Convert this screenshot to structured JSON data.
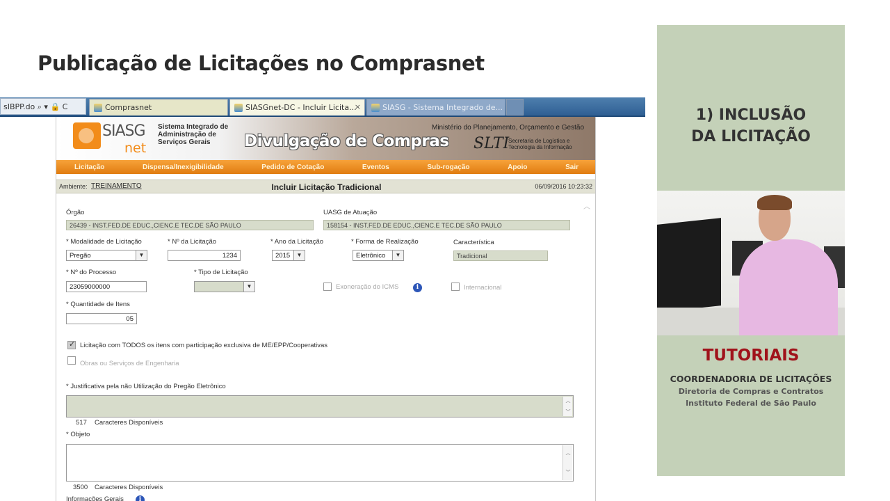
{
  "slide": {
    "title": "Publicação de Licitações no Comprasnet"
  },
  "browser": {
    "address_fragment": "sIBPP.do ⌕ ▾ 🔒 C",
    "tabs": [
      {
        "label": "Comprasnet"
      },
      {
        "label": "SIASGnet-DC - Incluir Licita...",
        "close": "×"
      },
      {
        "label": "SIASG - Sistema Integrado de..."
      }
    ]
  },
  "siasg": {
    "logo_text": "SIASG",
    "logo_suffix": "net",
    "system_name": "Sistema Integrado de Administração de Serviços Gerais",
    "banner_title": "Divulgação de Compras",
    "ministry": "Ministério do Planejamento, Orçamento e Gestão",
    "slti_logo": "SLTI",
    "slti_desc": "Secretaria de Logística e Tecnologia da Informação",
    "menu": [
      "Licitação",
      "Dispensa/Inexigibilidade",
      "Pedido de Cotação",
      "Eventos",
      "Sub-rogação",
      "Apoio",
      "Sair"
    ],
    "environment_label": "Ambiente:",
    "environment_value": "TREINAMENTO",
    "page_heading": "Incluir Licitação Tradicional",
    "datetime": "06/09/2016 10:23:32"
  },
  "form": {
    "orgao": {
      "label": "Órgão",
      "value": "26439 - INST.FED.DE EDUC.,CIENC.E TEC.DE SÃO PAULO"
    },
    "uasg": {
      "label": "UASG de Atuação",
      "value": "158154 - INST.FED.DE EDUC.,CIENC.E TEC.DE SÃO PAULO"
    },
    "modalidade": {
      "label": "* Modalidade de Licitação",
      "value": "Pregão"
    },
    "numero": {
      "label": "* Nº da Licitação",
      "value": "1234"
    },
    "ano": {
      "label": "* Ano da Licitação",
      "value": "2015"
    },
    "forma": {
      "label": "* Forma de Realização",
      "value": "Eletrônico"
    },
    "caracteristica": {
      "label": "Característica",
      "value": "Tradicional"
    },
    "processo": {
      "label": "* Nº do Processo",
      "value": "23059000000"
    },
    "tipo": {
      "label": "* Tipo de Licitação",
      "value": ""
    },
    "exclusividade_icms": {
      "label": "Exoneração do ICMS"
    },
    "internacional": {
      "label": "Internacional"
    },
    "quantidade": {
      "label": "* Quantidade de Itens",
      "value": "05"
    },
    "me_epp": {
      "label": "Licitação com TODOS os itens com participação exclusiva de ME/EPP/Cooperativas"
    },
    "obras": {
      "label": "Obras ou Serviços de Engenharia"
    },
    "justificativa": {
      "label": "* Justificativa pela não Utilização do Pregão Eletrônico",
      "count": "517",
      "count_label": "Caracteres Disponíveis"
    },
    "objeto": {
      "label": "* Objeto",
      "count": "3500",
      "count_label": "Caracteres Disponíveis"
    },
    "info_gerais": {
      "label": "Informações Gerais"
    }
  },
  "side_panel": {
    "step_line1": "1) INCLUSÃO",
    "step_line2": "DA LICITAÇÃO",
    "brand": "TUTORIAIS",
    "coordination": "COORDENADORIA DE LICITAÇÕES",
    "directorate": "Diretoria de Compras e Contratos",
    "institute": "Instituto Federal de São Paulo",
    "accent_color": "#a0121a",
    "background_color": "#c4d1b8"
  }
}
